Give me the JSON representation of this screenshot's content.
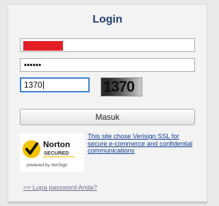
{
  "login": {
    "title": "Login",
    "username_value": "",
    "password_value": "••••••",
    "captcha_value": "1370",
    "captcha_image_text": "1370",
    "submit_label": "Masuk",
    "ssl_link_text": "This site chose Verisign SSL for secure e-commerce and confidential communications",
    "forgot_link": ">> Lupa password Anda?"
  },
  "badge": {
    "brand": "Norton",
    "secured": "SECURED",
    "powered_by": "powered by VeriSign"
  },
  "colors": {
    "title": "#1f3f73",
    "redaction": "#e31e24",
    "focus_border": "#3b7fd0",
    "link": "#0b3c8f"
  }
}
